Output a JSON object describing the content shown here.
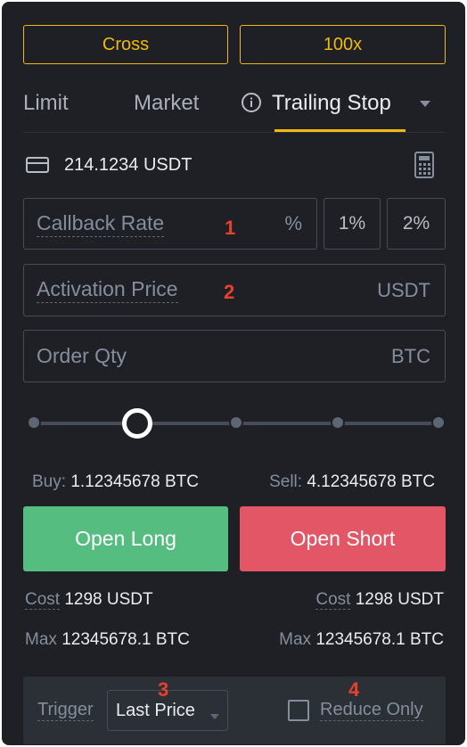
{
  "mode": {
    "margin_label": "Cross",
    "leverage_label": "100x"
  },
  "tabs": [
    {
      "label": "Limit"
    },
    {
      "label": "Market"
    },
    {
      "label": "Trailing Stop"
    }
  ],
  "balance": {
    "value": "214.1234 USDT"
  },
  "fields": {
    "callback": {
      "placeholder": "Callback Rate",
      "unit": "%",
      "marker": "1"
    },
    "activation": {
      "placeholder": "Activation Price",
      "unit": "USDT",
      "marker": "2"
    },
    "qty": {
      "placeholder": "Order Qty",
      "unit": "BTC"
    }
  },
  "quick_pct": [
    "1%",
    "2%"
  ],
  "slider": {
    "level_percent": 25
  },
  "buy": {
    "label": "Buy:",
    "value": "1.12345678 BTC"
  },
  "sell": {
    "label": "Sell:",
    "value": "4.12345678 BTC"
  },
  "buttons": {
    "long": "Open Long",
    "short": "Open Short"
  },
  "cost_left": {
    "label": "Cost",
    "value": "1298 USDT"
  },
  "cost_right": {
    "label": "Cost",
    "value": "1298 USDT"
  },
  "max_left": {
    "label": "Max",
    "value": "12345678.1 BTC"
  },
  "max_right": {
    "label": "Max",
    "value": "12345678.1 BTC"
  },
  "trigger": {
    "label": "Trigger",
    "selected": "Last Price",
    "marker": "3"
  },
  "reduce_only": {
    "label": "Reduce Only",
    "checked": false,
    "marker": "4"
  },
  "colors": {
    "accent": "#f0b90b",
    "long": "#55bd80",
    "short": "#e35665",
    "annotation": "#e8402c"
  }
}
